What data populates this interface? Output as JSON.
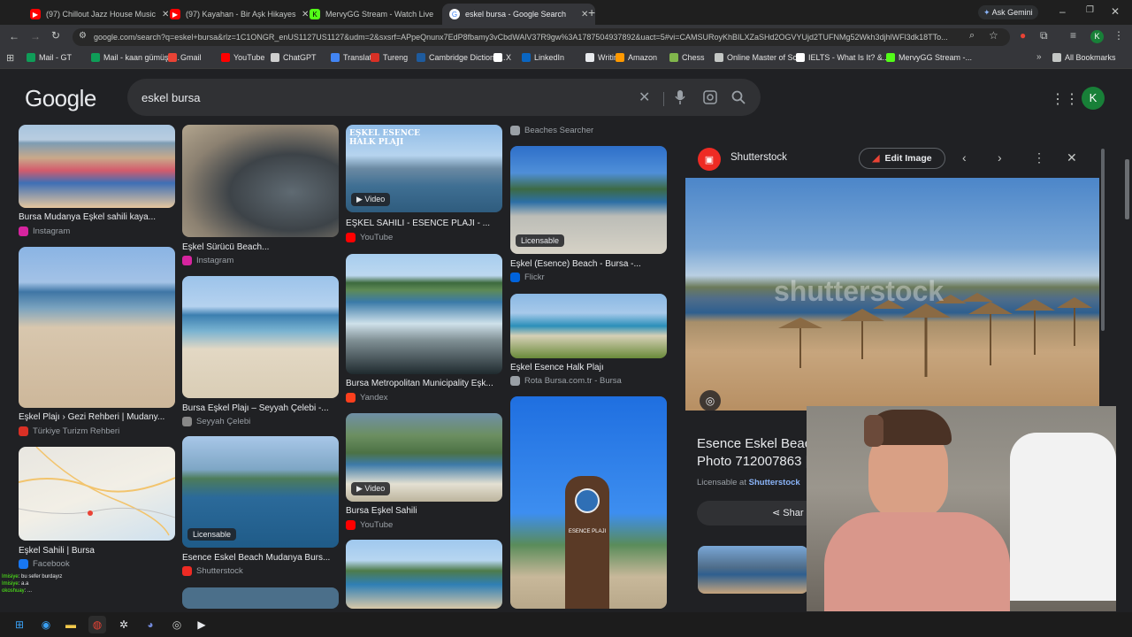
{
  "tabs": [
    {
      "title": "(97) Chillout Jazz House Music",
      "favicon_color": "#ff0000"
    },
    {
      "title": "(97) Kayahan - Bir Aşk Hikayesi",
      "favicon_color": "#ff0000"
    },
    {
      "title": "MervyGG Stream - Watch Live",
      "favicon_color": "#53fc18"
    },
    {
      "title": "eskel bursa - Google Search",
      "favicon_color": "#4285f4"
    }
  ],
  "ask_gemini": "Ask Gemini",
  "url": "google.com/search?q=eskel+bursa&rlz=1C1ONGR_enUS1127US1127&udm=2&sxsrf=APpeQnunx7EdP8fbamy3vCbdWAlV37R9gw%3A1787504937892&uact=5#vi=CAMSURoyKhBILXZaSHd2OGVYUjd2TUFNMg52Wkh3djhlWFl3dk18TTo...",
  "bookmarks": [
    {
      "label": "Mail - GT",
      "color": "#0f9d58"
    },
    {
      "label": "Mail - kaan gümüşd...",
      "color": "#0f9d58"
    },
    {
      "label": "Gmail",
      "color": "#ea4335"
    },
    {
      "label": "YouTube",
      "color": "#ff0000"
    },
    {
      "label": "ChatGPT",
      "color": "#cfcfcf"
    },
    {
      "label": "Translate",
      "color": "#4285f4"
    },
    {
      "label": "Tureng",
      "color": "#d93025"
    },
    {
      "label": "Cambridge Dictiona...",
      "color": "#1e5b9e"
    },
    {
      "label": "X",
      "color": "#ffffff"
    },
    {
      "label": "LinkedIn",
      "color": "#0a66c2"
    },
    {
      "label": "Writing",
      "color": "#e8eaed"
    },
    {
      "label": "Amazon",
      "color": "#ff9900"
    },
    {
      "label": "Chess",
      "color": "#81b64c"
    },
    {
      "label": "Online Master of Sci...",
      "color": "#c4c7c5"
    },
    {
      "label": "IELTS - What Is It? &...",
      "color": "#ffffff"
    },
    {
      "label": "MervyGG Stream -...",
      "color": "#53fc18"
    }
  ],
  "all_bookmarks": "All Bookmarks",
  "google_logo": "Google",
  "search_query": "eskel bursa",
  "avatar_letter": "K",
  "results": [
    {
      "caption": "Bursa Mudanya Eşkel sahili kaya...",
      "source": "Instagram",
      "src_color": "#d6249f"
    },
    {
      "caption": "Eşkel Plajı › Gezi Rehberi | Mudany...",
      "source": "Türkiye Turizm Rehberi",
      "src_color": "#d93025"
    },
    {
      "caption": "Eşkel Sahili | Bursa",
      "source": "Facebook",
      "src_color": "#1877f2"
    },
    {
      "caption": "Eşkel Sürücü Beach...",
      "source": "Instagram",
      "src_color": "#d6249f"
    },
    {
      "caption": "Bursa Eşkel Plajı – Seyyah Çelebi -...",
      "source": "Seyyah Çelebi",
      "src_color": "#888888"
    },
    {
      "caption": "Esence Eskel Beach Mudanya Burs...",
      "source": "Shutterstock",
      "src_color": "#ee2b24",
      "badge": "Licensable"
    },
    {
      "caption": "EŞKEL SAHİLİ - ESENCE PLAJI - ...",
      "source": "YouTube",
      "src_color": "#ff0000",
      "badge": "Video"
    },
    {
      "caption": "Bursa Metropolitan Municipality Eşk...",
      "source": "Yandex",
      "src_color": "#fc3f1d"
    },
    {
      "caption": "Bursa Eşkel Sahili",
      "source": "YouTube",
      "src_color": "#ff0000",
      "badge": "Video"
    },
    {
      "caption": "Eşkel (Esence) Beach - Bursa -...",
      "source": "Flickr",
      "src_color": "#0063dc",
      "badge": "Licensable"
    },
    {
      "caption": "Eşkel Esence Halk Plajı",
      "source": "Rota Bursa.com.tr - Bursa",
      "src_color": "#9aa0a6"
    }
  ],
  "beaches_searcher": "Beaches Searcher",
  "image_overlay_text": "EŞKEL ESENCE HALK PLAJI",
  "sign_text": "ESENCE PLAJI",
  "panel": {
    "site": "Shutterstock",
    "edit_label": "Edit Image",
    "title_line1": "Esence Eskel Beac",
    "title_line2": "Photo 712007863 |",
    "licensable_prefix": "Licensable at",
    "licensable_site": "Shutterstock",
    "share_label": "Shar",
    "watermark": "shutterstock"
  },
  "chat": [
    {
      "user": "Imisiye",
      "msg": ": bu sefer burdayız"
    },
    {
      "user": "Imisiye",
      "msg": ": a.a"
    },
    {
      "user": "okoshuay",
      "msg": ": ..."
    }
  ]
}
